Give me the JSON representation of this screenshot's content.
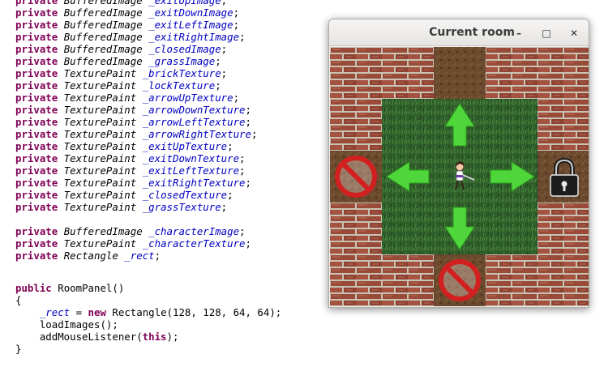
{
  "editor": {
    "lines": [
      {
        "kw": "private",
        "type": "BufferedImage",
        "field": "_exitUpImage",
        "end": ";"
      },
      {
        "kw": "private",
        "type": "BufferedImage",
        "field": "_exitDownImage",
        "end": ";"
      },
      {
        "kw": "private",
        "type": "BufferedImage",
        "field": "_exitLeftImage",
        "end": ";"
      },
      {
        "kw": "private",
        "type": "BufferedImage",
        "field": "_exitRightImage",
        "end": ";"
      },
      {
        "kw": "private",
        "type": "BufferedImage",
        "field": "_closedImage",
        "end": ";"
      },
      {
        "kw": "private",
        "type": "BufferedImage",
        "field": "_grassImage",
        "end": ";"
      },
      {
        "kw": "private",
        "type": "TexturePaint",
        "field": "_brickTexture",
        "end": ";"
      },
      {
        "kw": "private",
        "type": "TexturePaint",
        "field": "_lockTexture",
        "end": ";"
      },
      {
        "kw": "private",
        "type": "TexturePaint",
        "field": "_arrowUpTexture",
        "end": ";"
      },
      {
        "kw": "private",
        "type": "TexturePaint",
        "field": "_arrowDownTexture",
        "end": ";"
      },
      {
        "kw": "private",
        "type": "TexturePaint",
        "field": "_arrowLeftTexture",
        "end": ";"
      },
      {
        "kw": "private",
        "type": "TexturePaint",
        "field": "_arrowRightTexture",
        "end": ";"
      },
      {
        "kw": "private",
        "type": "TexturePaint",
        "field": "_exitUpTexture",
        "end": ";"
      },
      {
        "kw": "private",
        "type": "TexturePaint",
        "field": "_exitDownTexture",
        "end": ";"
      },
      {
        "kw": "private",
        "type": "TexturePaint",
        "field": "_exitLeftTexture",
        "end": ";"
      },
      {
        "kw": "private",
        "type": "TexturePaint",
        "field": "_exitRightTexture",
        "end": ";"
      },
      {
        "kw": "private",
        "type": "TexturePaint",
        "field": "_closedTexture",
        "end": ";"
      },
      {
        "kw": "private",
        "type": "TexturePaint",
        "field": "_grassTexture",
        "end": ";"
      },
      {
        "kw": "private",
        "type": "BufferedImage",
        "field": "_characterImage",
        "end": ";"
      },
      {
        "kw": "private",
        "type": "TexturePaint",
        "field": "_characterTexture",
        "end": ";"
      },
      {
        "kw": "private",
        "type": "Rectangle",
        "field": "_rect",
        "end": ";"
      }
    ],
    "constructor": {
      "kw": "public",
      "name": "RoomPanel()",
      "open": "{",
      "rect_field": "_rect",
      "assign": " = ",
      "new_kw": "new",
      "rect_call": " Rectangle(128, 128, 64, 64);",
      "load": "loadImages();",
      "listener_pre": "addMouseListener(",
      "this_kw": "this",
      "listener_post": ");",
      "close": "}"
    }
  },
  "window": {
    "title": "Current room",
    "minimize_glyph": "–",
    "maximize_glyph": "□",
    "close_glyph": "✕"
  },
  "room": {
    "exits": {
      "up": "open",
      "down": "closed",
      "left": "closed",
      "right": "locked"
    },
    "colors": {
      "brick": "#9a4a38",
      "mortar": "#c9c3b4",
      "grass": "#2f5e2a",
      "dirt": "#6b4a2e",
      "arrow": "#4fd63a",
      "no_entry": "#d21f1f"
    }
  }
}
